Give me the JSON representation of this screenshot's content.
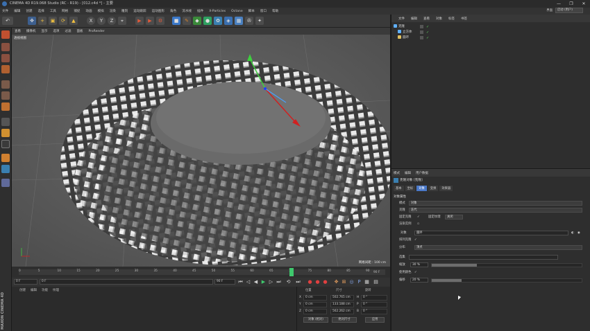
{
  "window": {
    "title": "CINEMA 4D R19.068 Studio (RC - R19) - [012.c4d *] - 主要",
    "controls": [
      "—",
      "❐",
      "✕"
    ]
  },
  "menubar": [
    "文件",
    "编辑",
    "创建",
    "选择",
    "工具",
    "网格",
    "捕捉",
    "动画",
    "模拟",
    "渲染",
    "雕刻",
    "运动跟踪",
    "运动图形",
    "角色",
    "流水线",
    "插件",
    "X-Particles",
    "Octane",
    "脚本",
    "窗口",
    "帮助"
  ],
  "layout": {
    "label": "界面",
    "value": "启动 (用户)"
  },
  "viewport_menu": [
    "查看",
    "摄像机",
    "显示",
    "选项",
    "过滤",
    "面板",
    "ProRender"
  ],
  "viewport": {
    "label": "透视视图",
    "grid_distance": "网格间距 : 100 cm"
  },
  "timeline": {
    "ticks": [
      "0",
      "5",
      "10",
      "15",
      "20",
      "25",
      "30",
      "35",
      "40",
      "45",
      "50",
      "55",
      "60",
      "65",
      "70",
      "75",
      "80",
      "85",
      "90"
    ],
    "end_marker": "90 F",
    "current_frame_fraction": 0.78
  },
  "transport": {
    "start": "0 F",
    "start2": "0 F",
    "end": "90 F",
    "end2": "90 F"
  },
  "material_menu": [
    "创建",
    "编辑",
    "功能",
    "纹理"
  ],
  "coords": {
    "headers": [
      "位置",
      "尺寸",
      "旋转"
    ],
    "rows": [
      {
        "axis": "X",
        "pos": "0 cm",
        "size": "502.765 cm",
        "rot_label": "H",
        "rot": "0 °"
      },
      {
        "axis": "Y",
        "pos": "0 cm",
        "size": "133.188 cm",
        "rot_label": "P",
        "rot": "0 °"
      },
      {
        "axis": "Z",
        "pos": "0 cm",
        "size": "562.262 cm",
        "rot_label": "B",
        "rot": "0 °"
      }
    ],
    "mode": "对象 (相对)",
    "size_mode": "绝对尺寸",
    "apply": "应用"
  },
  "maxon": "MAXON CINEMA 4D",
  "object_manager": {
    "menu": [
      "文件",
      "编辑",
      "查看",
      "对象",
      "标签",
      "书签"
    ],
    "objects": [
      {
        "name": "克隆",
        "color": "#5fb0ff"
      },
      {
        "name": "立方体",
        "color": "#5fb0ff"
      },
      {
        "name": "圆环",
        "color": "#e0c060"
      }
    ]
  },
  "attribute_manager": {
    "menu": [
      "模式",
      "编辑",
      "用户数据"
    ],
    "title": "克隆对象 [克隆]",
    "tabs": [
      "基本",
      "坐标",
      "对象",
      "变换",
      "效果器"
    ],
    "active_tab": "对象",
    "section": "对象属性",
    "fields": {
      "mode_label": "模式",
      "mode_value": "对象",
      "clones_label": "克隆",
      "clones_value": "迭代",
      "fix_clone_label": "固定克隆",
      "fix_texture_label": "固定纹理",
      "fix_texture_value": "关闭",
      "render_instances_label": "渲染实例",
      "object_label": "对象",
      "object_value": "圆环",
      "align_label": "排列克隆",
      "distribution_label": "分布",
      "distribution_value": "顶点",
      "seed_label": "选集",
      "seed_value": "",
      "scale_label": "缩放",
      "scale_value": "30 %",
      "scale_fraction": 0.3,
      "use_color_label": "使用颜色",
      "vertex_color_label": "顶点颜色",
      "offset_label": "偏移",
      "offset_value": "20 %",
      "offset_fraction": 0.2
    }
  },
  "colors": {
    "accent": "#4a78c8",
    "play_green": "#3fc86d",
    "viewport_bg": "#5b5b5b"
  }
}
